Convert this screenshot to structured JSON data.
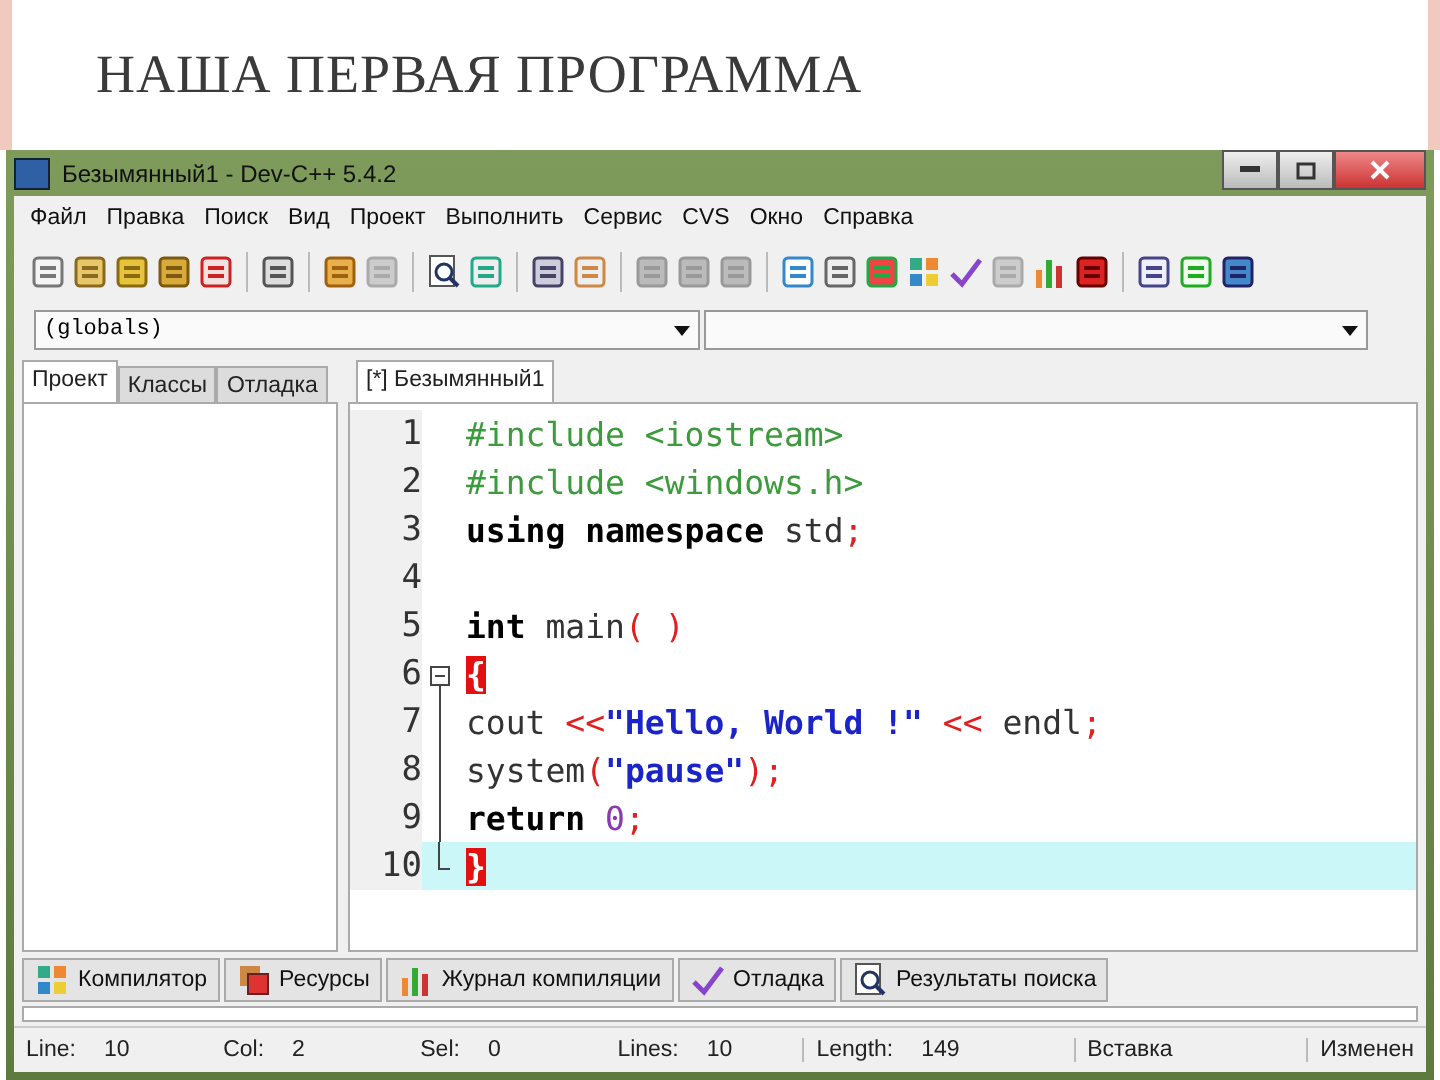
{
  "slide": {
    "title": "НАША ПЕРВАЯ ПРОГРАММА"
  },
  "window": {
    "title": "Безымянный1 - Dev-C++ 5.4.2"
  },
  "menu": [
    "Файл",
    "Правка",
    "Поиск",
    "Вид",
    "Проект",
    "Выполнить",
    "Сервис",
    "CVS",
    "Окно",
    "Справка"
  ],
  "combos": [
    {
      "value": "(globals)",
      "disabled": false
    },
    {
      "disabled": false
    }
  ],
  "side_tabs": [
    {
      "label": "Проект",
      "selected": true
    },
    {
      "label": "Классы",
      "selected": false
    },
    {
      "label": "Отладка",
      "selected": false
    }
  ],
  "editor_tabs": [
    {
      "label": "[*] Безымянный1",
      "selected": true
    }
  ],
  "code": [
    {
      "number": "1",
      "current": false,
      "fold_start": false,
      "fold_end": false,
      "tokens": [
        {
          "kind": "pp",
          "text": "#include <iostream>"
        }
      ]
    },
    {
      "number": "2",
      "current": false,
      "fold_start": false,
      "fold_end": false,
      "tokens": [
        {
          "kind": "pp",
          "text": "#include <windows.h>"
        }
      ]
    },
    {
      "number": "3",
      "current": false,
      "fold_start": false,
      "fold_end": false,
      "tokens": [
        {
          "kind": "kw",
          "text": "using namespace"
        },
        {
          "kind": "id",
          "text": " std"
        },
        {
          "kind": "sym",
          "text": ";"
        }
      ]
    },
    {
      "number": "4",
      "current": false,
      "fold_start": false,
      "fold_end": false
    },
    {
      "number": "5",
      "current": false,
      "fold_start": false,
      "fold_end": false,
      "tokens": [
        {
          "kind": "kw",
          "text": "int"
        },
        {
          "kind": "id",
          "text": " main"
        },
        {
          "kind": "sym",
          "text": "( )"
        }
      ]
    },
    {
      "number": "6",
      "current": false,
      "fold_start": true,
      "fold_end": false,
      "tokens": [
        {
          "kind": "brace",
          "text": "{"
        }
      ]
    },
    {
      "number": "7",
      "current": false,
      "fold_start": false,
      "fold_end": false,
      "tokens": [
        {
          "kind": "id",
          "text": "cout "
        },
        {
          "kind": "sym",
          "text": "<<"
        },
        {
          "kind": "str",
          "text": "\"Hello, World !\""
        },
        {
          "kind": "sym",
          "text": " << "
        },
        {
          "kind": "id",
          "text": "endl"
        },
        {
          "kind": "sym",
          "text": ";"
        }
      ]
    },
    {
      "number": "8",
      "current": false,
      "fold_start": false,
      "fold_end": false,
      "tokens": [
        {
          "kind": "id",
          "text": "system"
        },
        {
          "kind": "sym",
          "text": "("
        },
        {
          "kind": "str",
          "text": "\"pause\""
        },
        {
          "kind": "sym",
          "text": ");"
        }
      ]
    },
    {
      "number": "9",
      "current": false,
      "fold_start": false,
      "fold_end": false,
      "tokens": [
        {
          "kind": "kw",
          "text": "return"
        },
        {
          "kind": "num",
          "text": " 0"
        },
        {
          "kind": "sym",
          "text": ";"
        }
      ]
    },
    {
      "number": "10",
      "current": true,
      "fold_start": false,
      "fold_end": true,
      "tokens": [
        {
          "kind": "brace",
          "text": "}"
        }
      ]
    }
  ],
  "bottom_tabs": [
    {
      "label": "Компилятор",
      "selected": false
    },
    {
      "label": "Ресурсы",
      "selected": false
    },
    {
      "label": "Журнал компиляции",
      "selected": false
    },
    {
      "label": "Отладка",
      "selected": false
    },
    {
      "label": "Результаты поиска",
      "selected": false
    }
  ],
  "status_bar": [
    {
      "label": "Line:",
      "value": "10"
    },
    {
      "label": "Col:",
      "value": "2"
    },
    {
      "label": "Sel:",
      "value": "0"
    },
    {
      "label": "Lines:",
      "value": "10"
    },
    {
      "label": "Length:",
      "value": "149"
    },
    {
      "value": "Вставка"
    },
    {
      "value": "Изменен"
    }
  ]
}
